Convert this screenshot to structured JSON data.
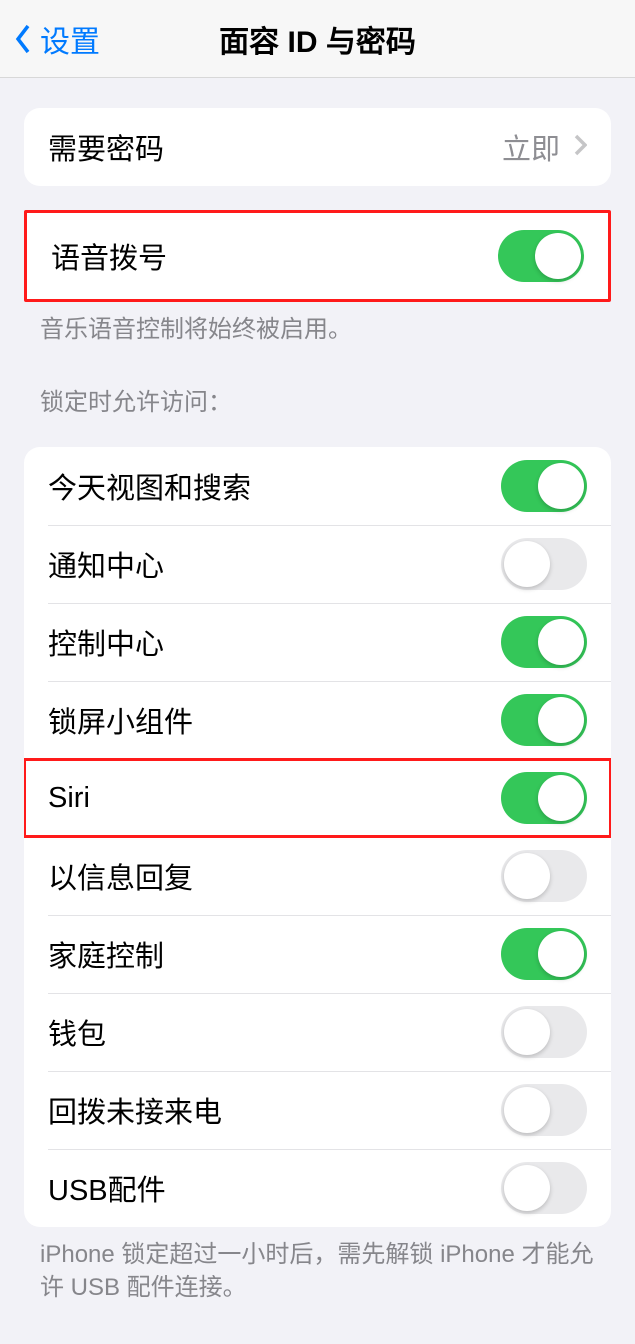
{
  "nav": {
    "back_label": "设置",
    "title": "面容 ID 与密码"
  },
  "require_passcode": {
    "label": "需要密码",
    "value": "立即"
  },
  "voice_dial": {
    "label": "语音拨号",
    "on": true,
    "footer": "音乐语音控制将始终被启用。"
  },
  "locked_access": {
    "header": "锁定时允许访问：",
    "items": [
      {
        "label": "今天视图和搜索",
        "on": true
      },
      {
        "label": "通知中心",
        "on": false
      },
      {
        "label": "控制中心",
        "on": true
      },
      {
        "label": "锁屏小组件",
        "on": true
      },
      {
        "label": "Siri",
        "on": true,
        "highlighted": true
      },
      {
        "label": "以信息回复",
        "on": false
      },
      {
        "label": "家庭控制",
        "on": true
      },
      {
        "label": "钱包",
        "on": false
      },
      {
        "label": "回拨未接来电",
        "on": false
      },
      {
        "label": "USB配件",
        "on": false
      }
    ],
    "footer": "iPhone 锁定超过一小时后，需先解锁 iPhone 才能允许 USB 配件连接。"
  }
}
